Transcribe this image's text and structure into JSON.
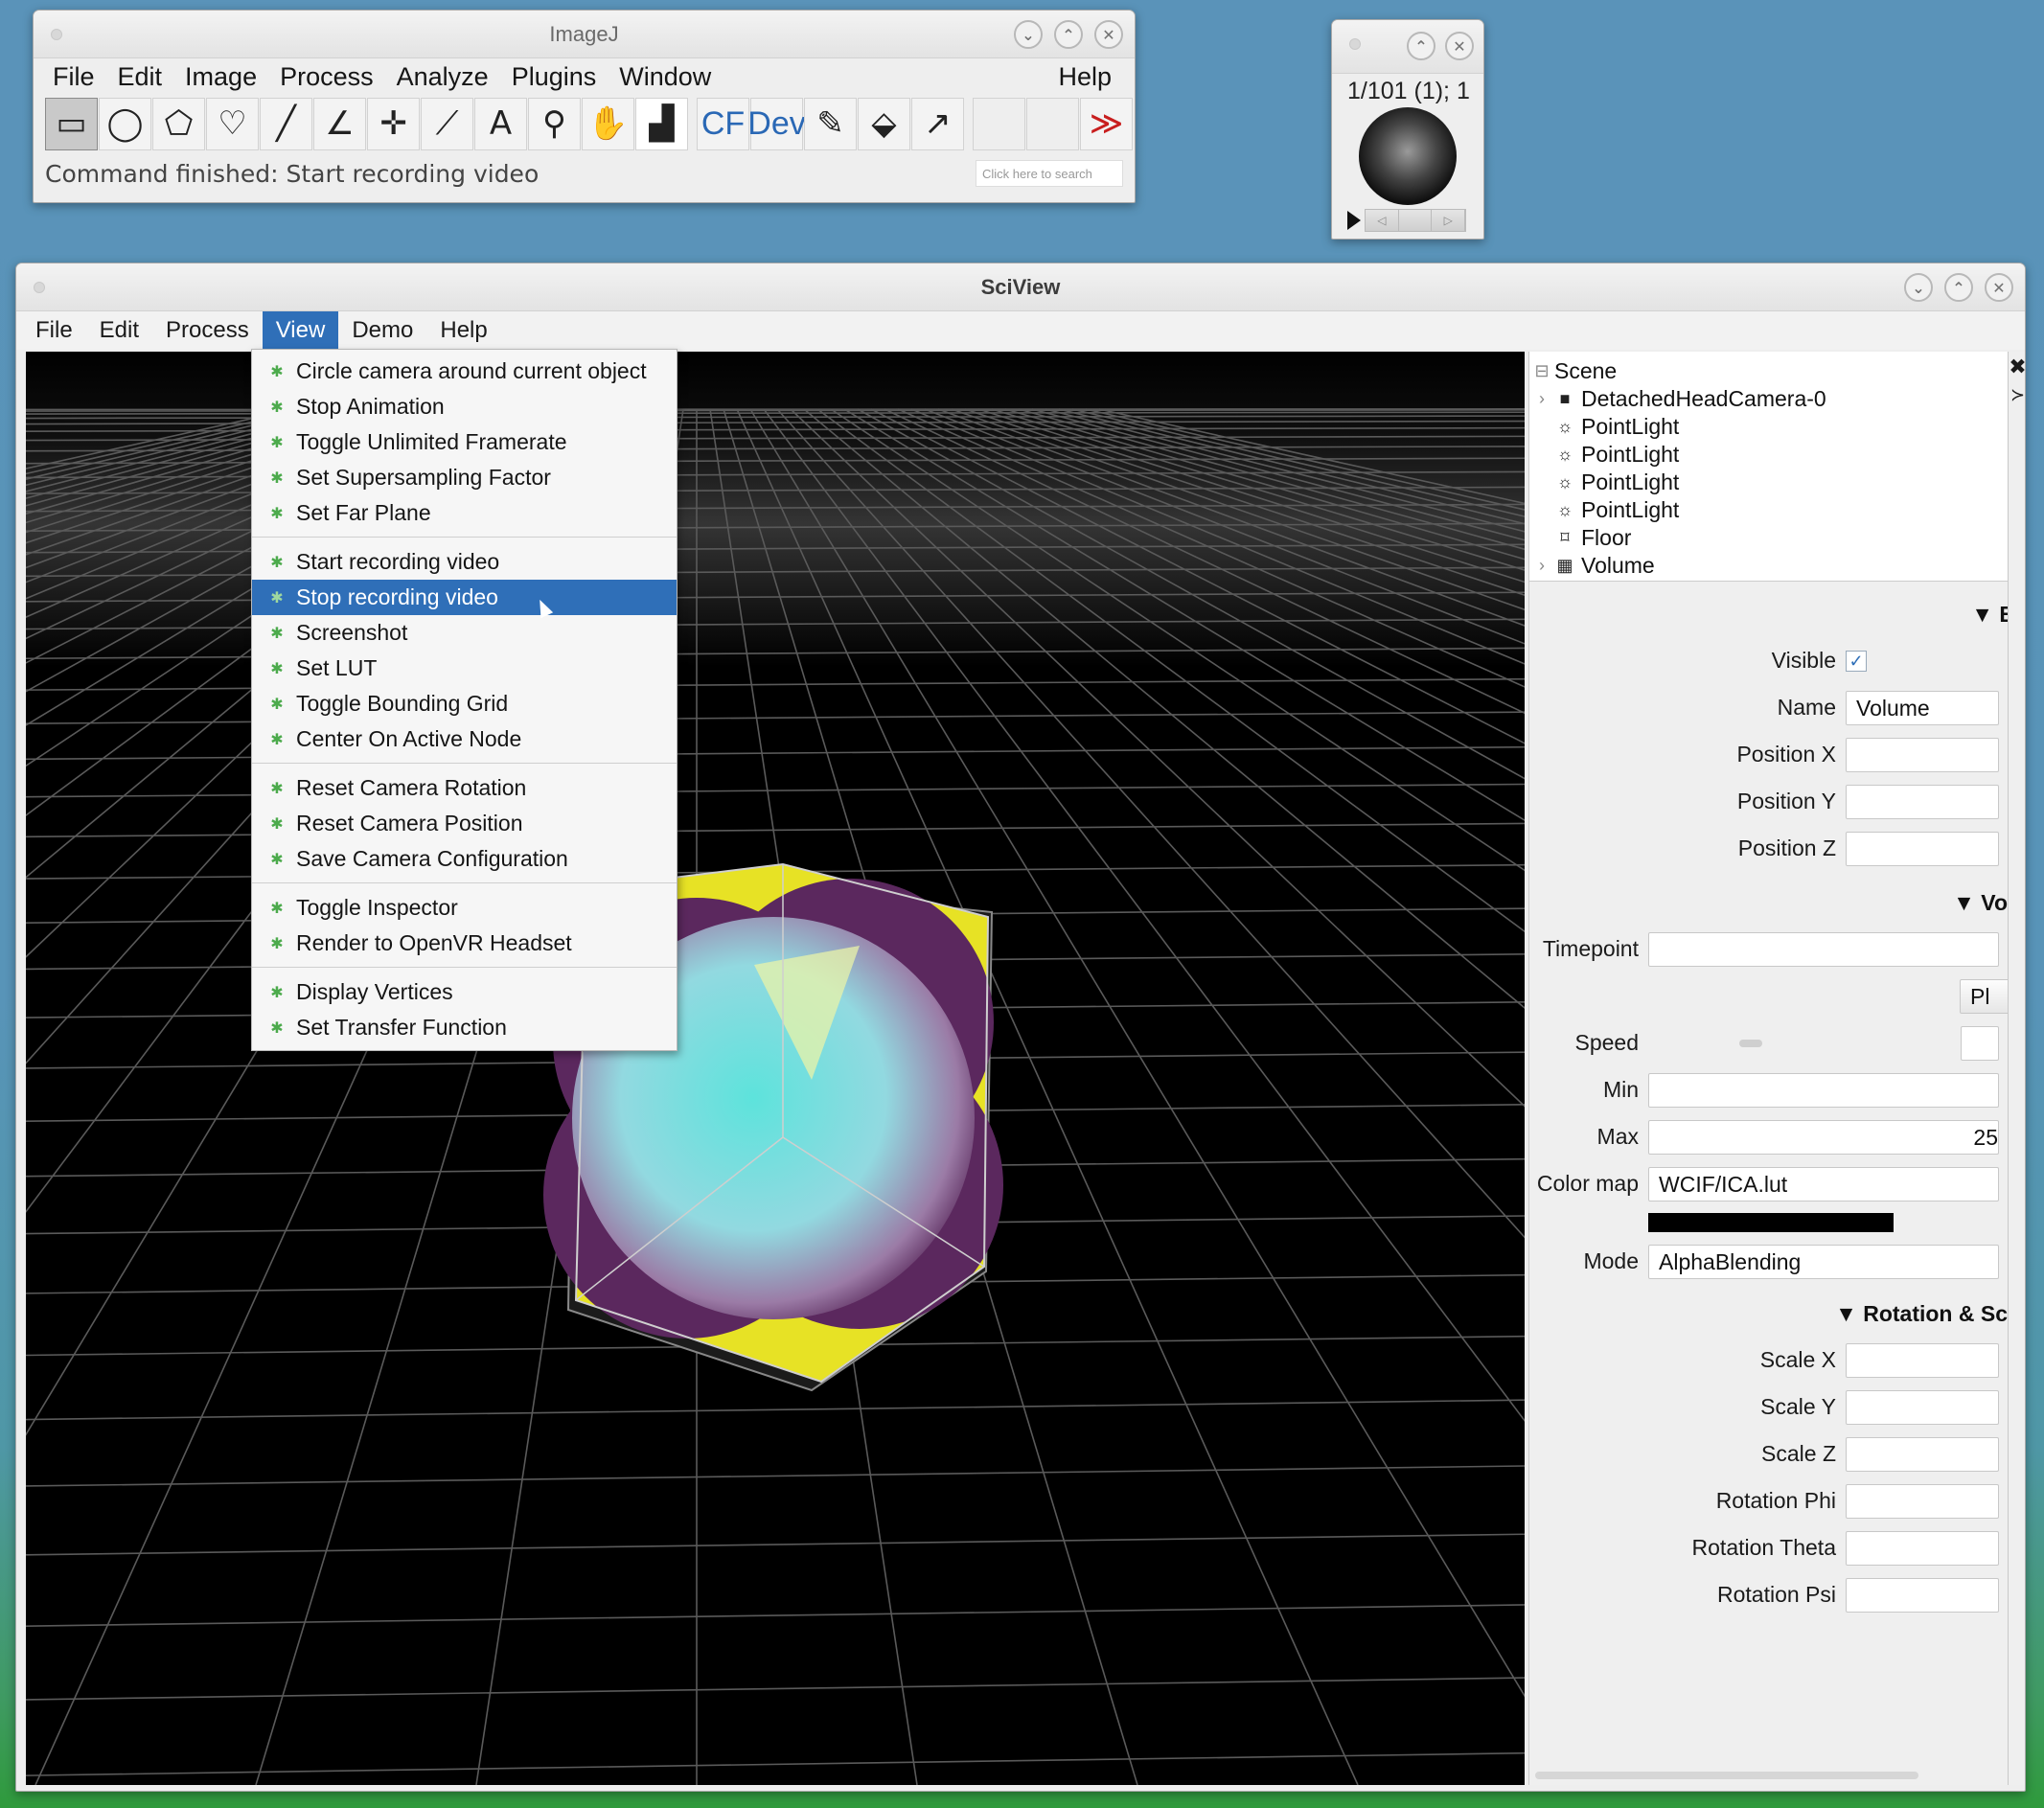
{
  "imagej": {
    "title": "ImageJ",
    "menu": [
      "File",
      "Edit",
      "Image",
      "Process",
      "Analyze",
      "Plugins",
      "Window"
    ],
    "help": "Help",
    "tools": [
      {
        "name": "rectangle-tool-icon",
        "glyph": "▭",
        "active": true,
        "dropdown": true
      },
      {
        "name": "oval-tool-icon",
        "glyph": "◯",
        "dropdown": true
      },
      {
        "name": "polygon-tool-icon",
        "glyph": "⬠"
      },
      {
        "name": "freehand-tool-icon",
        "glyph": "♡"
      },
      {
        "name": "line-tool-icon",
        "glyph": "╱",
        "dropdown": true
      },
      {
        "name": "angle-tool-icon",
        "glyph": "∠"
      },
      {
        "name": "multipoint-tool-icon",
        "glyph": "✛",
        "dropdown": true
      },
      {
        "name": "wand-tool-icon",
        "glyph": "⟋"
      },
      {
        "name": "text-tool-icon",
        "glyph": "A"
      },
      {
        "name": "zoom-tool-icon",
        "glyph": "⚲"
      },
      {
        "name": "hand-tool-icon",
        "glyph": "✋"
      },
      {
        "name": "color-picker-icon",
        "glyph": "▟"
      },
      {
        "name": "cf-tool-icon",
        "glyph": "CF",
        "text": true
      },
      {
        "name": "dev-tool-icon",
        "glyph": "Dev",
        "text": true,
        "dropdown": true
      },
      {
        "name": "brush-tool-icon",
        "glyph": "✎"
      },
      {
        "name": "flood-fill-icon",
        "glyph": "⬙"
      },
      {
        "name": "arrow-tool-icon",
        "glyph": "↗"
      },
      {
        "name": "empty-slot-icon",
        "glyph": ""
      },
      {
        "name": "empty-slot-icon",
        "glyph": ""
      },
      {
        "name": "more-tools-icon",
        "glyph": "≫",
        "red": true
      }
    ],
    "status": "Command finished: Start recording video",
    "search_placeholder": "Click here to search"
  },
  "viewer": {
    "label": "1/101 (1); 1"
  },
  "sciview": {
    "title": "SciView",
    "menu": [
      "File",
      "Edit",
      "Process",
      "View",
      "Demo",
      "Help"
    ],
    "open_menu": "View",
    "view_menu": [
      [
        "Circle camera around current object",
        "Stop Animation",
        "Toggle Unlimited Framerate",
        "Set Supersampling Factor",
        "Set Far Plane"
      ],
      [
        "Start recording video",
        "Stop recording video",
        "Screenshot",
        "Set LUT",
        "Toggle Bounding Grid",
        "Center On Active Node"
      ],
      [
        "Reset Camera Rotation",
        "Reset Camera Position",
        "Save Camera Configuration"
      ],
      [
        "Toggle Inspector",
        "Render to OpenVR Headset"
      ],
      [
        "Display Vertices",
        "Set Transfer Function"
      ]
    ],
    "highlighted_item": "Stop recording video",
    "tree": {
      "root": "Scene",
      "nodes": [
        {
          "label": "DetachedHeadCamera-0",
          "icon": "camera-icon",
          "expandable": true
        },
        {
          "label": "PointLight",
          "icon": "light-icon"
        },
        {
          "label": "PointLight",
          "icon": "light-icon"
        },
        {
          "label": "PointLight",
          "icon": "light-icon"
        },
        {
          "label": "PointLight",
          "icon": "light-icon"
        },
        {
          "label": "Floor",
          "icon": "floor-icon"
        },
        {
          "label": "Volume",
          "icon": "volume-icon",
          "expandable": true
        }
      ]
    },
    "props": {
      "section1": "▼ B",
      "visible_label": "Visible",
      "visible": true,
      "name_label": "Name",
      "name_value": "Volume",
      "pos_x_label": "Position X",
      "pos_y_label": "Position Y",
      "pos_z_label": "Position Z",
      "section2": "▼ Vo",
      "timepoint_label": "Timepoint",
      "play_button": "Pl",
      "speed_label": "Speed",
      "min_label": "Min",
      "max_label": "Max",
      "max_value": "25",
      "colormap_label": "Color map",
      "colormap_value": "WCIF/ICA.lut",
      "mode_label": "Mode",
      "mode_value": "AlphaBlending",
      "section3": "▼ Rotation & Sc",
      "scale_x_label": "Scale X",
      "scale_y_label": "Scale Y",
      "scale_z_label": "Scale Z",
      "rot_phi_label": "Rotation Phi",
      "rot_theta_label": "Rotation Theta",
      "rot_psi_label": "Rotation Psi"
    },
    "colors": {
      "accent": "#2f6fb8",
      "menu_icon": "#4caa4c",
      "volume_cyan": "#7fe9e4",
      "volume_purple": "#6b2e6a",
      "volume_yellow": "#f2ee21"
    }
  }
}
